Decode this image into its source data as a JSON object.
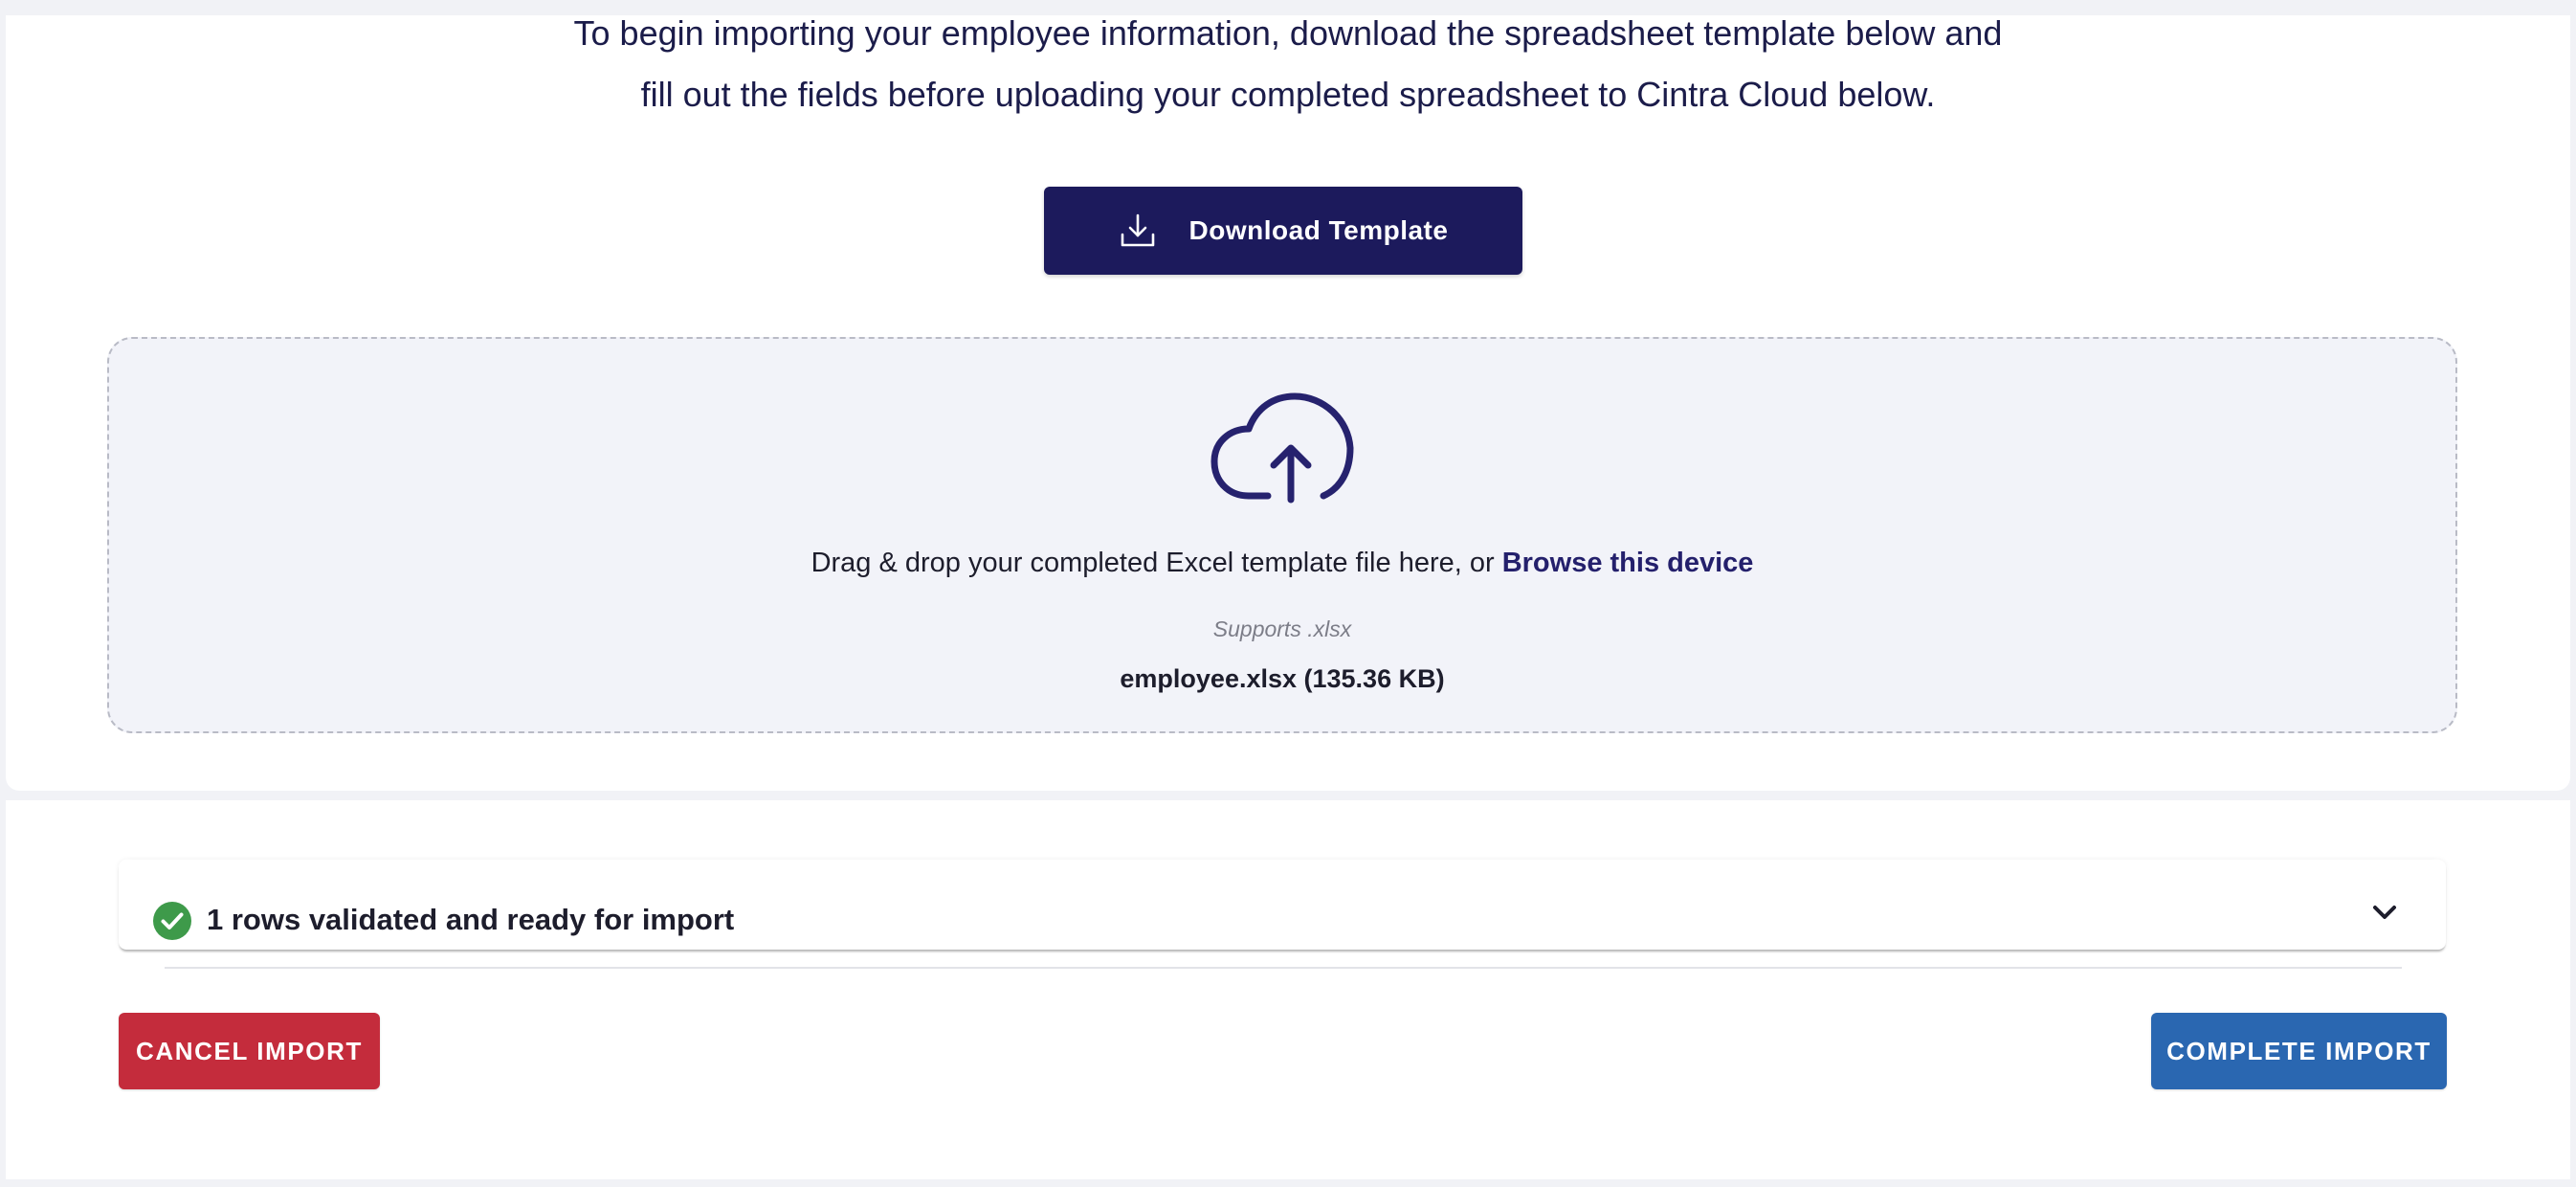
{
  "intro": {
    "line1": "To begin importing your employee information, download the spreadsheet template below and",
    "line2": "fill out the fields before uploading your completed spreadsheet to Cintra Cloud below."
  },
  "download_button": {
    "label": "Download Template",
    "icon": "download-icon"
  },
  "dropzone": {
    "icon": "cloud-upload-icon",
    "prompt": "Drag & drop your completed Excel template file here, or ",
    "browse_link": "Browse this device",
    "supports": "Supports .xlsx",
    "file": "employee.xlsx (135.36 KB)"
  },
  "validation": {
    "icon": "check-circle-icon",
    "message": "1 rows validated and ready for import",
    "toggle_icon": "chevron-down-icon"
  },
  "actions": {
    "cancel_label": "CANCEL IMPORT",
    "complete_label": "COMPLETE IMPORT"
  },
  "colors": {
    "primary_navy": "#1c1a5c",
    "cancel_red": "#c42c3c",
    "complete_blue": "#2a67b1",
    "success_green": "#3e9a4a",
    "dropzone_bg": "#f2f3f9"
  }
}
